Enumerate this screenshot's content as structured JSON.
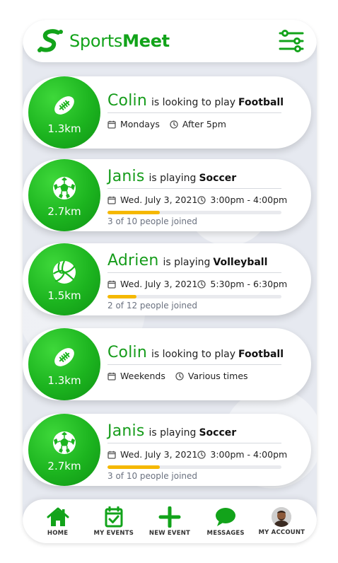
{
  "app": {
    "brand_light": "Sports",
    "brand_bold": "Meet",
    "accent": "#12a31a",
    "progress_color": "#f5b800"
  },
  "header": {
    "filter_icon": "sliders-icon",
    "logo_icon": "swoosh-s-logo"
  },
  "cards": [
    {
      "name": "Colin",
      "verb": "is looking to play",
      "sport": "Football",
      "sport_icon": "football-icon",
      "distance": "1.3km",
      "date": "Mondays",
      "time": "After 5pm",
      "show_progress": false
    },
    {
      "name": "Janis",
      "verb": "is playing",
      "sport": "Soccer",
      "sport_icon": "soccer-ball-icon",
      "distance": "2.7km",
      "date": "Wed. July 3, 2021",
      "time": "3:00pm - 4:00pm",
      "show_progress": true,
      "joined": 3,
      "capacity": 10,
      "joined_text": "3 of 10 people joined"
    },
    {
      "name": "Adrien",
      "verb": "is playing",
      "sport": "Volleyball",
      "sport_icon": "volleyball-icon",
      "distance": "1.5km",
      "date": "Wed. July 3, 2021",
      "time": "5:30pm - 6:30pm",
      "show_progress": true,
      "joined": 2,
      "capacity": 12,
      "joined_text": "2 of 12 people joined"
    },
    {
      "name": "Colin",
      "verb": "is looking to play",
      "sport": "Football",
      "sport_icon": "football-icon",
      "distance": "1.3km",
      "date": "Weekends",
      "time": "Various times",
      "show_progress": false
    },
    {
      "name": "Janis",
      "verb": "is playing",
      "sport": "Soccer",
      "sport_icon": "soccer-ball-icon",
      "distance": "2.7km",
      "date": "Wed. July 3, 2021",
      "time": "3:00pm - 4:00pm",
      "show_progress": true,
      "joined": 3,
      "capacity": 10,
      "joined_text": "3 of 10 people joined"
    }
  ],
  "nav": [
    {
      "label": "HOME",
      "icon": "home-icon"
    },
    {
      "label": "MY EVENTS",
      "icon": "calendar-check-icon"
    },
    {
      "label": "NEW EVENT",
      "icon": "plus-icon"
    },
    {
      "label": "MESSAGES",
      "icon": "chat-bubble-icon"
    },
    {
      "label": "MY ACCOUNT",
      "icon": "avatar"
    }
  ]
}
